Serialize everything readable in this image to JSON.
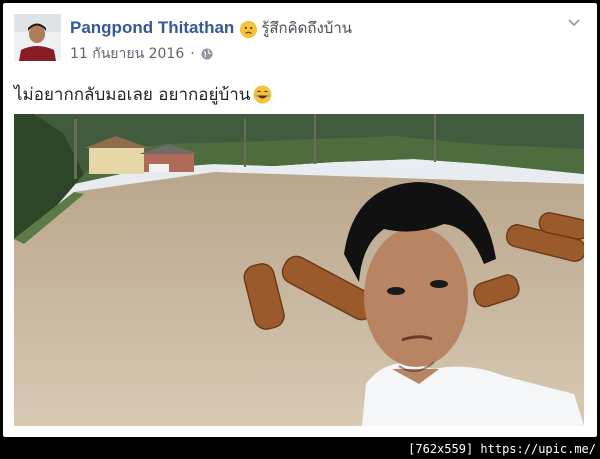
{
  "post": {
    "author": "Pangpond Thitathan",
    "feeling": "รู้สึกคิดถึงบ้าน",
    "date": "11 กันยายน 2016",
    "separator": "·",
    "text": "ไม่อยากกลับมอเลย อยากอยู่บ้าน",
    "feeling_icon": "sad-face-icon",
    "privacy_icon": "globe-icon",
    "text_emoji": "laughing-face-icon"
  },
  "watermark": "[762x559] https://upic.me/",
  "colors": {
    "author_link": "#365899",
    "meta_text": "#616770",
    "background": "#000000"
  }
}
